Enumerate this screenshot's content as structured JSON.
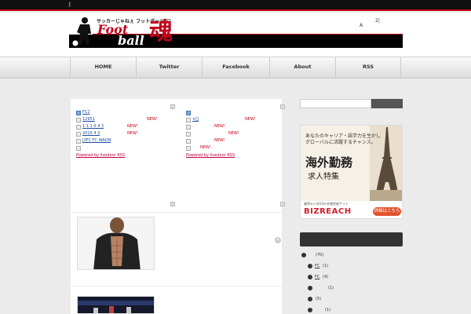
{
  "topbar": {
    "text": "J"
  },
  "header": {
    "tagline": "サッカーじゃねぇ フットボールだ！",
    "logo_word_1": "Foot",
    "logo_word_2": "ball",
    "logo_kanji": "魂",
    "right_a": "A",
    "right_2": "2|"
  },
  "nav": {
    "items": [
      {
        "label": "HOME"
      },
      {
        "label": "Twitter"
      },
      {
        "label": "Facebook"
      },
      {
        "label": "About"
      },
      {
        "label": "RSS"
      }
    ]
  },
  "feeds": {
    "left": {
      "lines": [
        {
          "text": "FC2",
          "new": ""
        },
        {
          "text": "12951",
          "new": "NEW!"
        },
        {
          "text": "1 1 1 0 4 3",
          "new": "NEW!"
        },
        {
          "text": "2015 4 3",
          "new": "NEW!"
        },
        {
          "text": "J3FC FC WAON",
          "new": ""
        },
        {
          "text": "",
          "new": ""
        }
      ],
      "powered": "Powered by livedoor RSS"
    },
    "right": {
      "lines": [
        {
          "text": "",
          "new": ""
        },
        {
          "text": "×[]",
          "new": "NEW!"
        },
        {
          "text": "",
          "new": "NEW!"
        },
        {
          "text": "",
          "new": "NEW!"
        },
        {
          "text": "",
          "new": "NEW!"
        },
        {
          "text": "",
          "new": "NEW!"
        }
      ],
      "powered": "Powered by livedoor RSS"
    }
  },
  "ad": {
    "line1": "あなたのキャリア・語学力を生かし",
    "line2": "グローバルに活躍するチャンス。",
    "headline": "海外勤務",
    "subhead": "求人特集",
    "small": "業界の人材10の合格性能サイト",
    "brand": "BIZREACH",
    "button": "詳細はこちら"
  },
  "categories": {
    "heading": "",
    "items": [
      {
        "label": "",
        "count": "(70)"
      },
      {
        "label": "FC",
        "count": "(1)"
      },
      {
        "label": "FC",
        "count": "(4)"
      },
      {
        "label": "",
        "count": "(1)"
      },
      {
        "label": "",
        "count": "(5)"
      },
      {
        "label": "",
        "count": "(1)"
      }
    ]
  },
  "colors": {
    "accent": "#c0001a",
    "topbar": "#111111",
    "new_label": "#c0001a"
  }
}
